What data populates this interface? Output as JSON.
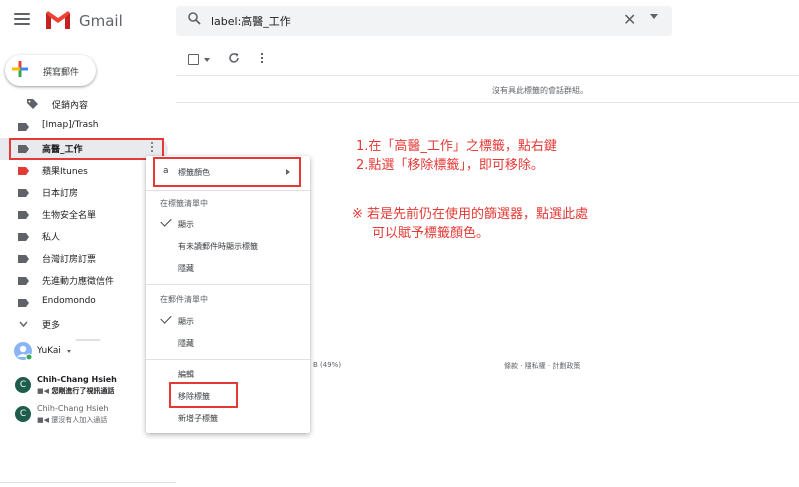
{
  "app": {
    "name": "Gmail"
  },
  "search": {
    "query": "label:高醫_工作"
  },
  "compose": {
    "label": "撰寫郵件"
  },
  "sidebar": {
    "items": [
      {
        "label": "促銷內容",
        "icon": "tag-icon",
        "color": "#5f6368"
      },
      {
        "label": "[Imap]/Trash",
        "icon": "label-icon",
        "color": "#5f6368"
      },
      {
        "label": "高醫_工作",
        "icon": "label-icon",
        "color": "#5f6368",
        "active": true
      },
      {
        "label": "蘋果Itunes",
        "icon": "label-icon",
        "color": "#e53935"
      },
      {
        "label": "日本訂房",
        "icon": "label-icon",
        "color": "#5f6368"
      },
      {
        "label": "生物安全名單",
        "icon": "label-icon",
        "color": "#5f6368"
      },
      {
        "label": "私人",
        "icon": "label-icon",
        "color": "#5f6368"
      },
      {
        "label": "台灣訂房訂票",
        "icon": "label-icon",
        "color": "#5f6368"
      },
      {
        "label": "先進動力應徵信件",
        "icon": "label-icon",
        "color": "#5f6368"
      },
      {
        "label": "Endomondo",
        "icon": "label-icon",
        "color": "#5f6368"
      },
      {
        "label": "更多",
        "icon": "chevron-down-icon",
        "color": "#5f6368"
      }
    ]
  },
  "hangouts": {
    "user": "YuKai",
    "chats": [
      {
        "initial": "C",
        "name": "Chih-Chang Hsieh",
        "preview": "您剛進行了視訊通話",
        "bold": true
      },
      {
        "initial": "C",
        "name": "Chih-Chang Hsieh",
        "preview": "還沒有人加入通話",
        "bold": false
      }
    ]
  },
  "main": {
    "empty_message": "沒有具此標籤的會話群組。",
    "storage": "B (49%)",
    "footer_links": "條款 · 隱私權 · 計劃政策"
  },
  "annotation": {
    "line1": "1.在「高醫_工作」之標籤，點右鍵",
    "line2": "2.點選「移除標籤」，即可移除。",
    "line3": "※ 若是先前仍在使用的篩選器，點選此處",
    "line4": "可以賦予標籤顏色。"
  },
  "menu": {
    "label_color": "標籤顏色",
    "label_color_icon": "a",
    "section1_title": "在標籤清單中",
    "show1": "顯示",
    "show_if_unread": "有未讀郵件時顯示標籤",
    "hide1": "隱藏",
    "section2_title": "在郵件清單中",
    "show2": "顯示",
    "hide2": "隱藏",
    "edit": "編輯",
    "remove_label": "移除標籤",
    "add_sublabel": "新增子標籤"
  },
  "colors": {
    "accent_red": "#e53935",
    "active_bg": "#e8eaed"
  }
}
